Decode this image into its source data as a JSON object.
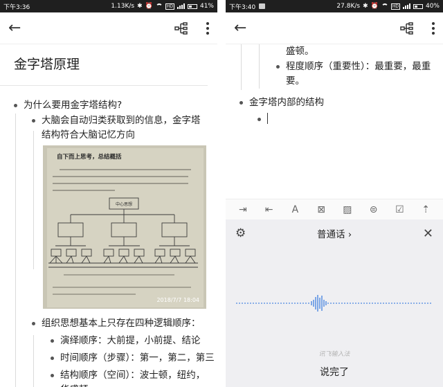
{
  "left": {
    "status": {
      "time": "下午3:36",
      "speed": "1.13K/s",
      "battery": "41%"
    },
    "title": "金字塔原理",
    "items": [
      {
        "text": "为什么要用金字塔结构?"
      },
      {
        "text": "大脑会自动归类获取到的信息，金字塔结构符合大脑记忆方向"
      },
      {
        "text": "组织思想基本上只存在四种逻辑顺序："
      },
      {
        "text": "演绎顺序：大前提，小前提、结论"
      },
      {
        "text": "时间顺序（步骤）：第一，第二，第三"
      },
      {
        "text": "结构顺序（空间）：波士顿，纽约，华盛顿"
      }
    ],
    "photo": {
      "heading": "自下而上思考，总结概括",
      "box_label": "中心思想",
      "timestamp": "2018/7/7 18:04"
    }
  },
  "right": {
    "status": {
      "time": "下午3:40",
      "speed": "27.8K/s",
      "battery": "40%"
    },
    "items": [
      {
        "text": "盛顿。"
      },
      {
        "text": "程度顺序（重要性）：最重要，最重要。"
      },
      {
        "text": "金字塔内部的结构"
      }
    ],
    "formatting_icons": [
      "indent-icon",
      "outdent-icon",
      "text-style-icon",
      "delete-node-icon",
      "image-icon",
      "note-icon",
      "checkbox-icon",
      "move-up-icon"
    ],
    "ime": {
      "language": "普通话 ›",
      "brand": "讯飞输入法",
      "done": "说完了"
    }
  },
  "colors": {
    "statusbar": "#1f1f1f",
    "wave": "#3d7fe0",
    "ime_bg": "#efeff2"
  }
}
